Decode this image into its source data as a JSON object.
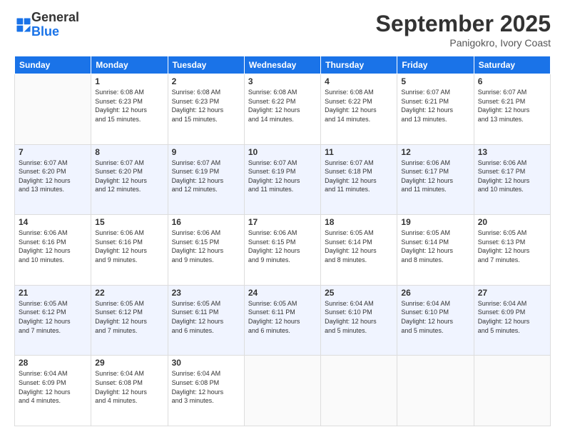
{
  "header": {
    "logo_general": "General",
    "logo_blue": "Blue",
    "month": "September 2025",
    "location": "Panigokro, Ivory Coast"
  },
  "weekdays": [
    "Sunday",
    "Monday",
    "Tuesday",
    "Wednesday",
    "Thursday",
    "Friday",
    "Saturday"
  ],
  "weeks": [
    [
      {
        "day": "",
        "info": ""
      },
      {
        "day": "1",
        "info": "Sunrise: 6:08 AM\nSunset: 6:23 PM\nDaylight: 12 hours\nand 15 minutes."
      },
      {
        "day": "2",
        "info": "Sunrise: 6:08 AM\nSunset: 6:23 PM\nDaylight: 12 hours\nand 15 minutes."
      },
      {
        "day": "3",
        "info": "Sunrise: 6:08 AM\nSunset: 6:22 PM\nDaylight: 12 hours\nand 14 minutes."
      },
      {
        "day": "4",
        "info": "Sunrise: 6:08 AM\nSunset: 6:22 PM\nDaylight: 12 hours\nand 14 minutes."
      },
      {
        "day": "5",
        "info": "Sunrise: 6:07 AM\nSunset: 6:21 PM\nDaylight: 12 hours\nand 13 minutes."
      },
      {
        "day": "6",
        "info": "Sunrise: 6:07 AM\nSunset: 6:21 PM\nDaylight: 12 hours\nand 13 minutes."
      }
    ],
    [
      {
        "day": "7",
        "info": "Sunrise: 6:07 AM\nSunset: 6:20 PM\nDaylight: 12 hours\nand 13 minutes."
      },
      {
        "day": "8",
        "info": "Sunrise: 6:07 AM\nSunset: 6:20 PM\nDaylight: 12 hours\nand 12 minutes."
      },
      {
        "day": "9",
        "info": "Sunrise: 6:07 AM\nSunset: 6:19 PM\nDaylight: 12 hours\nand 12 minutes."
      },
      {
        "day": "10",
        "info": "Sunrise: 6:07 AM\nSunset: 6:19 PM\nDaylight: 12 hours\nand 11 minutes."
      },
      {
        "day": "11",
        "info": "Sunrise: 6:07 AM\nSunset: 6:18 PM\nDaylight: 12 hours\nand 11 minutes."
      },
      {
        "day": "12",
        "info": "Sunrise: 6:06 AM\nSunset: 6:17 PM\nDaylight: 12 hours\nand 11 minutes."
      },
      {
        "day": "13",
        "info": "Sunrise: 6:06 AM\nSunset: 6:17 PM\nDaylight: 12 hours\nand 10 minutes."
      }
    ],
    [
      {
        "day": "14",
        "info": "Sunrise: 6:06 AM\nSunset: 6:16 PM\nDaylight: 12 hours\nand 10 minutes."
      },
      {
        "day": "15",
        "info": "Sunrise: 6:06 AM\nSunset: 6:16 PM\nDaylight: 12 hours\nand 9 minutes."
      },
      {
        "day": "16",
        "info": "Sunrise: 6:06 AM\nSunset: 6:15 PM\nDaylight: 12 hours\nand 9 minutes."
      },
      {
        "day": "17",
        "info": "Sunrise: 6:06 AM\nSunset: 6:15 PM\nDaylight: 12 hours\nand 9 minutes."
      },
      {
        "day": "18",
        "info": "Sunrise: 6:05 AM\nSunset: 6:14 PM\nDaylight: 12 hours\nand 8 minutes."
      },
      {
        "day": "19",
        "info": "Sunrise: 6:05 AM\nSunset: 6:14 PM\nDaylight: 12 hours\nand 8 minutes."
      },
      {
        "day": "20",
        "info": "Sunrise: 6:05 AM\nSunset: 6:13 PM\nDaylight: 12 hours\nand 7 minutes."
      }
    ],
    [
      {
        "day": "21",
        "info": "Sunrise: 6:05 AM\nSunset: 6:12 PM\nDaylight: 12 hours\nand 7 minutes."
      },
      {
        "day": "22",
        "info": "Sunrise: 6:05 AM\nSunset: 6:12 PM\nDaylight: 12 hours\nand 7 minutes."
      },
      {
        "day": "23",
        "info": "Sunrise: 6:05 AM\nSunset: 6:11 PM\nDaylight: 12 hours\nand 6 minutes."
      },
      {
        "day": "24",
        "info": "Sunrise: 6:05 AM\nSunset: 6:11 PM\nDaylight: 12 hours\nand 6 minutes."
      },
      {
        "day": "25",
        "info": "Sunrise: 6:04 AM\nSunset: 6:10 PM\nDaylight: 12 hours\nand 5 minutes."
      },
      {
        "day": "26",
        "info": "Sunrise: 6:04 AM\nSunset: 6:10 PM\nDaylight: 12 hours\nand 5 minutes."
      },
      {
        "day": "27",
        "info": "Sunrise: 6:04 AM\nSunset: 6:09 PM\nDaylight: 12 hours\nand 5 minutes."
      }
    ],
    [
      {
        "day": "28",
        "info": "Sunrise: 6:04 AM\nSunset: 6:09 PM\nDaylight: 12 hours\nand 4 minutes."
      },
      {
        "day": "29",
        "info": "Sunrise: 6:04 AM\nSunset: 6:08 PM\nDaylight: 12 hours\nand 4 minutes."
      },
      {
        "day": "30",
        "info": "Sunrise: 6:04 AM\nSunset: 6:08 PM\nDaylight: 12 hours\nand 3 minutes."
      },
      {
        "day": "",
        "info": ""
      },
      {
        "day": "",
        "info": ""
      },
      {
        "day": "",
        "info": ""
      },
      {
        "day": "",
        "info": ""
      }
    ]
  ]
}
